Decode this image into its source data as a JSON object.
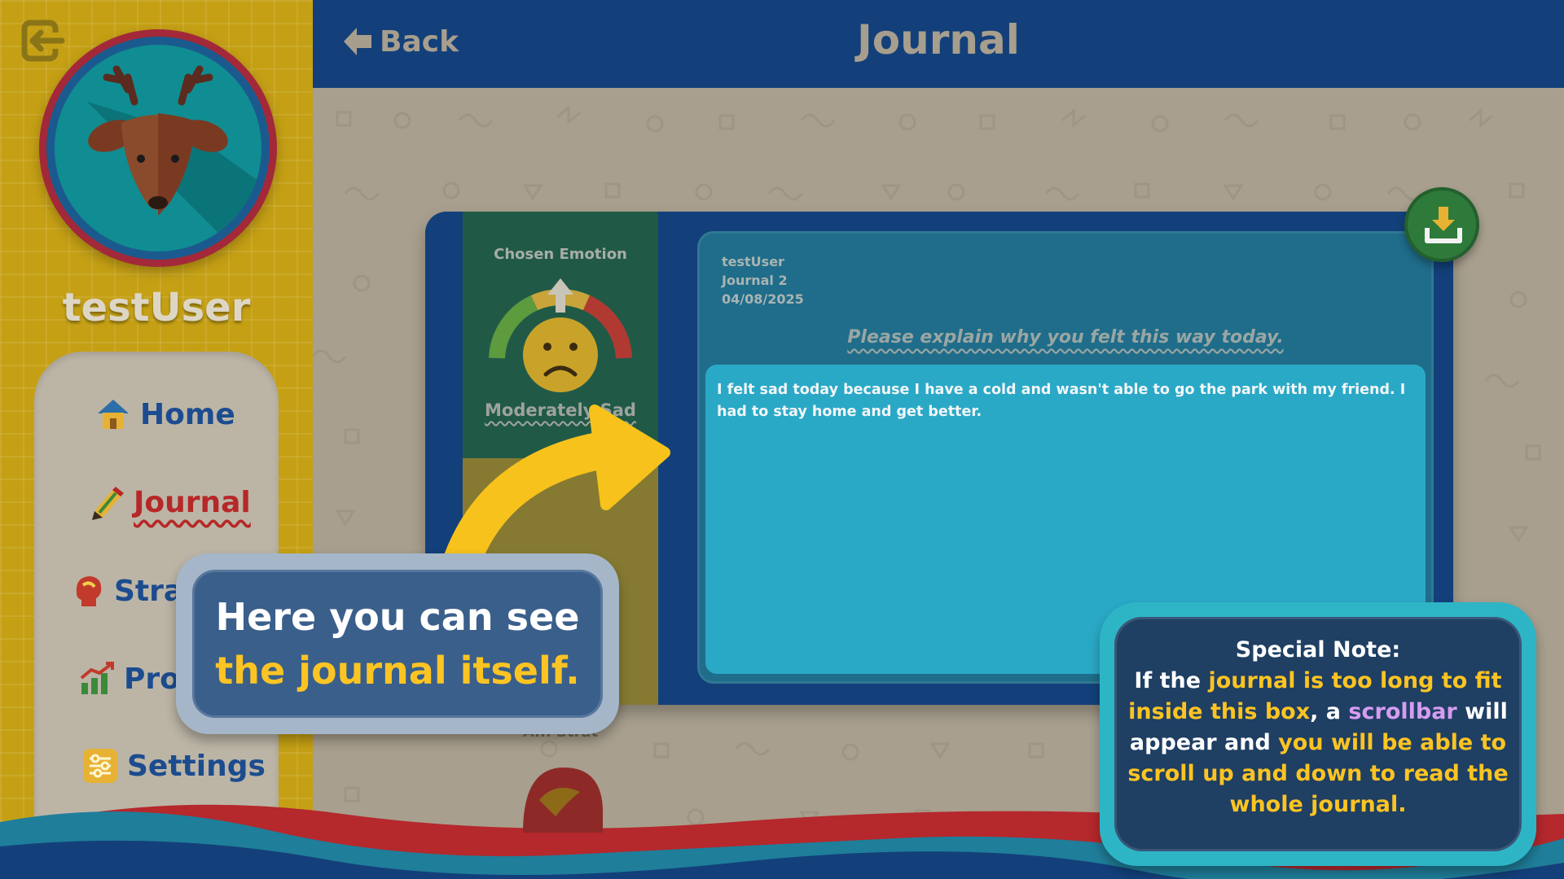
{
  "sidebar": {
    "username": "testUser",
    "nav": {
      "home": "Home",
      "journal": "Journal",
      "strategies": "Strat",
      "progress": "Prog",
      "settings": "Settings"
    }
  },
  "header": {
    "back_label": "Back",
    "title": "Journal"
  },
  "journal": {
    "chosen_emotion_label": "Chosen Emotion",
    "emotion_name": "Moderately Sad",
    "strategy_label_visible": "A... Strat",
    "user": "testUser",
    "entry_name": "Journal 2",
    "date": "04/08/2025",
    "prompt": "Please explain why you felt this way today.",
    "entry_text": "I felt sad today because I have a cold and wasn't able to go the park with my friend. I had to stay home and get better."
  },
  "callout": {
    "line1": "Here you can see",
    "line2": "the journal itself."
  },
  "note": {
    "title": "Special Note:",
    "p1": "If the ",
    "p2": "journal is too long to fit inside this box",
    "p3": ", a ",
    "p4": "scrollbar",
    "p5": " will appear and ",
    "p6": "you will be able to scroll up and down to read the whole journal."
  },
  "colors": {
    "header_bg": "#13407a",
    "sidebar_bg": "#c5a015",
    "accent_yellow": "#fcc423",
    "accent_purple": "#d59cf0",
    "journal_active": "#b62828",
    "download_green": "#2d7a3a"
  },
  "icons": {
    "exit": "exit-icon",
    "home": "house-icon",
    "journal": "pencil-icon",
    "strategies": "head-icon",
    "progress": "chart-icon",
    "settings": "sliders-icon",
    "back": "arrow-left-icon",
    "download": "download-icon"
  }
}
